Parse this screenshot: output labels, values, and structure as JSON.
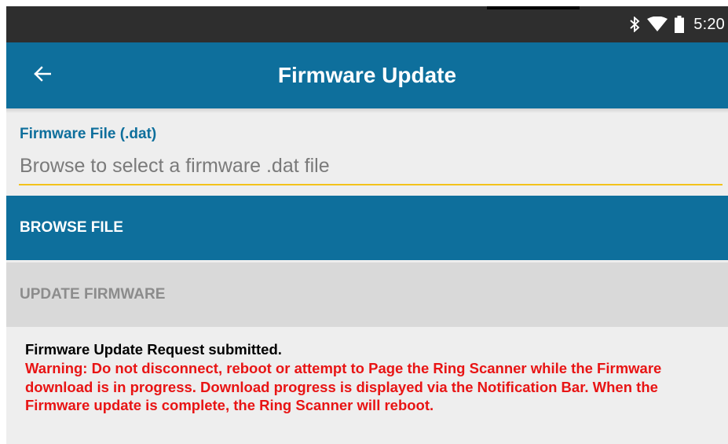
{
  "status_bar": {
    "time": "5:20",
    "icons": [
      "bluetooth-icon",
      "wifi-icon",
      "battery-icon"
    ]
  },
  "app_bar": {
    "title": "Firmware Update",
    "back_icon": "arrow-left-icon"
  },
  "firmware_field": {
    "label": "Firmware File (.dat)",
    "value": "",
    "placeholder": "Browse to select a firmware .dat file"
  },
  "buttons": {
    "browse_label": "BROWSE FILE",
    "update_label": "UPDATE FIRMWARE"
  },
  "messages": {
    "primary": "Firmware Update Request submitted.",
    "warning": "Warning: Do not disconnect, reboot or attempt to Page the Ring Scanner while the Firmware download is in progress. Download progress is displayed via the Notification Bar. When the Firmware update is complete, the Ring Scanner will reboot."
  },
  "colors": {
    "primary": "#0e6f9c",
    "accent_underline": "#f3c21b",
    "warning_text": "#e81414",
    "disabled_button": "#d9d9d9",
    "status_bar": "#2e2e2e",
    "background": "#eeeeee"
  }
}
